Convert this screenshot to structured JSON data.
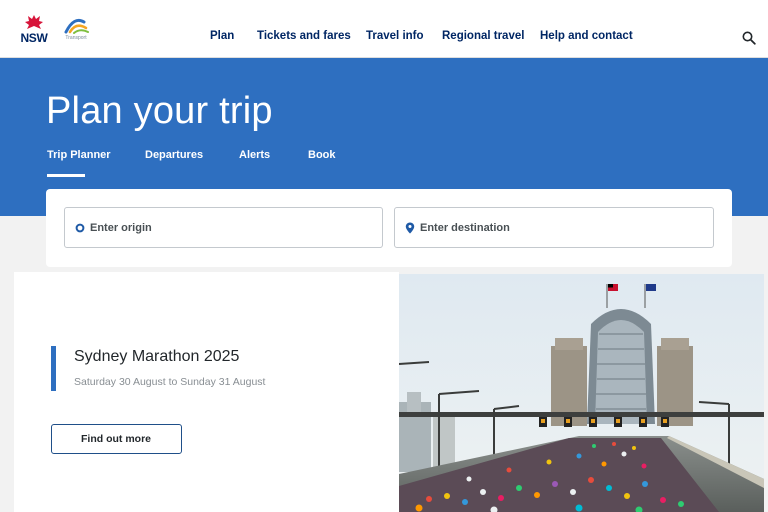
{
  "header": {
    "logos": {
      "nsw_text": "NSW",
      "transport_text": "Transport"
    },
    "nav": [
      "Plan",
      "Tickets and fares",
      "Travel info",
      "Regional travel",
      "Help and contact"
    ],
    "search_icon": "search-icon"
  },
  "hero": {
    "title": "Plan your trip",
    "tabs": [
      "Trip Planner",
      "Departures",
      "Alerts",
      "Book"
    ],
    "active_tab": "Trip Planner"
  },
  "planner": {
    "origin_placeholder": "Enter origin",
    "destination_placeholder": "Enter destination"
  },
  "feature": {
    "title": "Sydney Marathon 2025",
    "subtitle": "Saturday 30 August to Sunday 31 August",
    "cta_label": "Find out more"
  },
  "colors": {
    "brand_blue": "#2e6fc0",
    "navy": "#002664",
    "waratah_red": "#d7153a"
  }
}
